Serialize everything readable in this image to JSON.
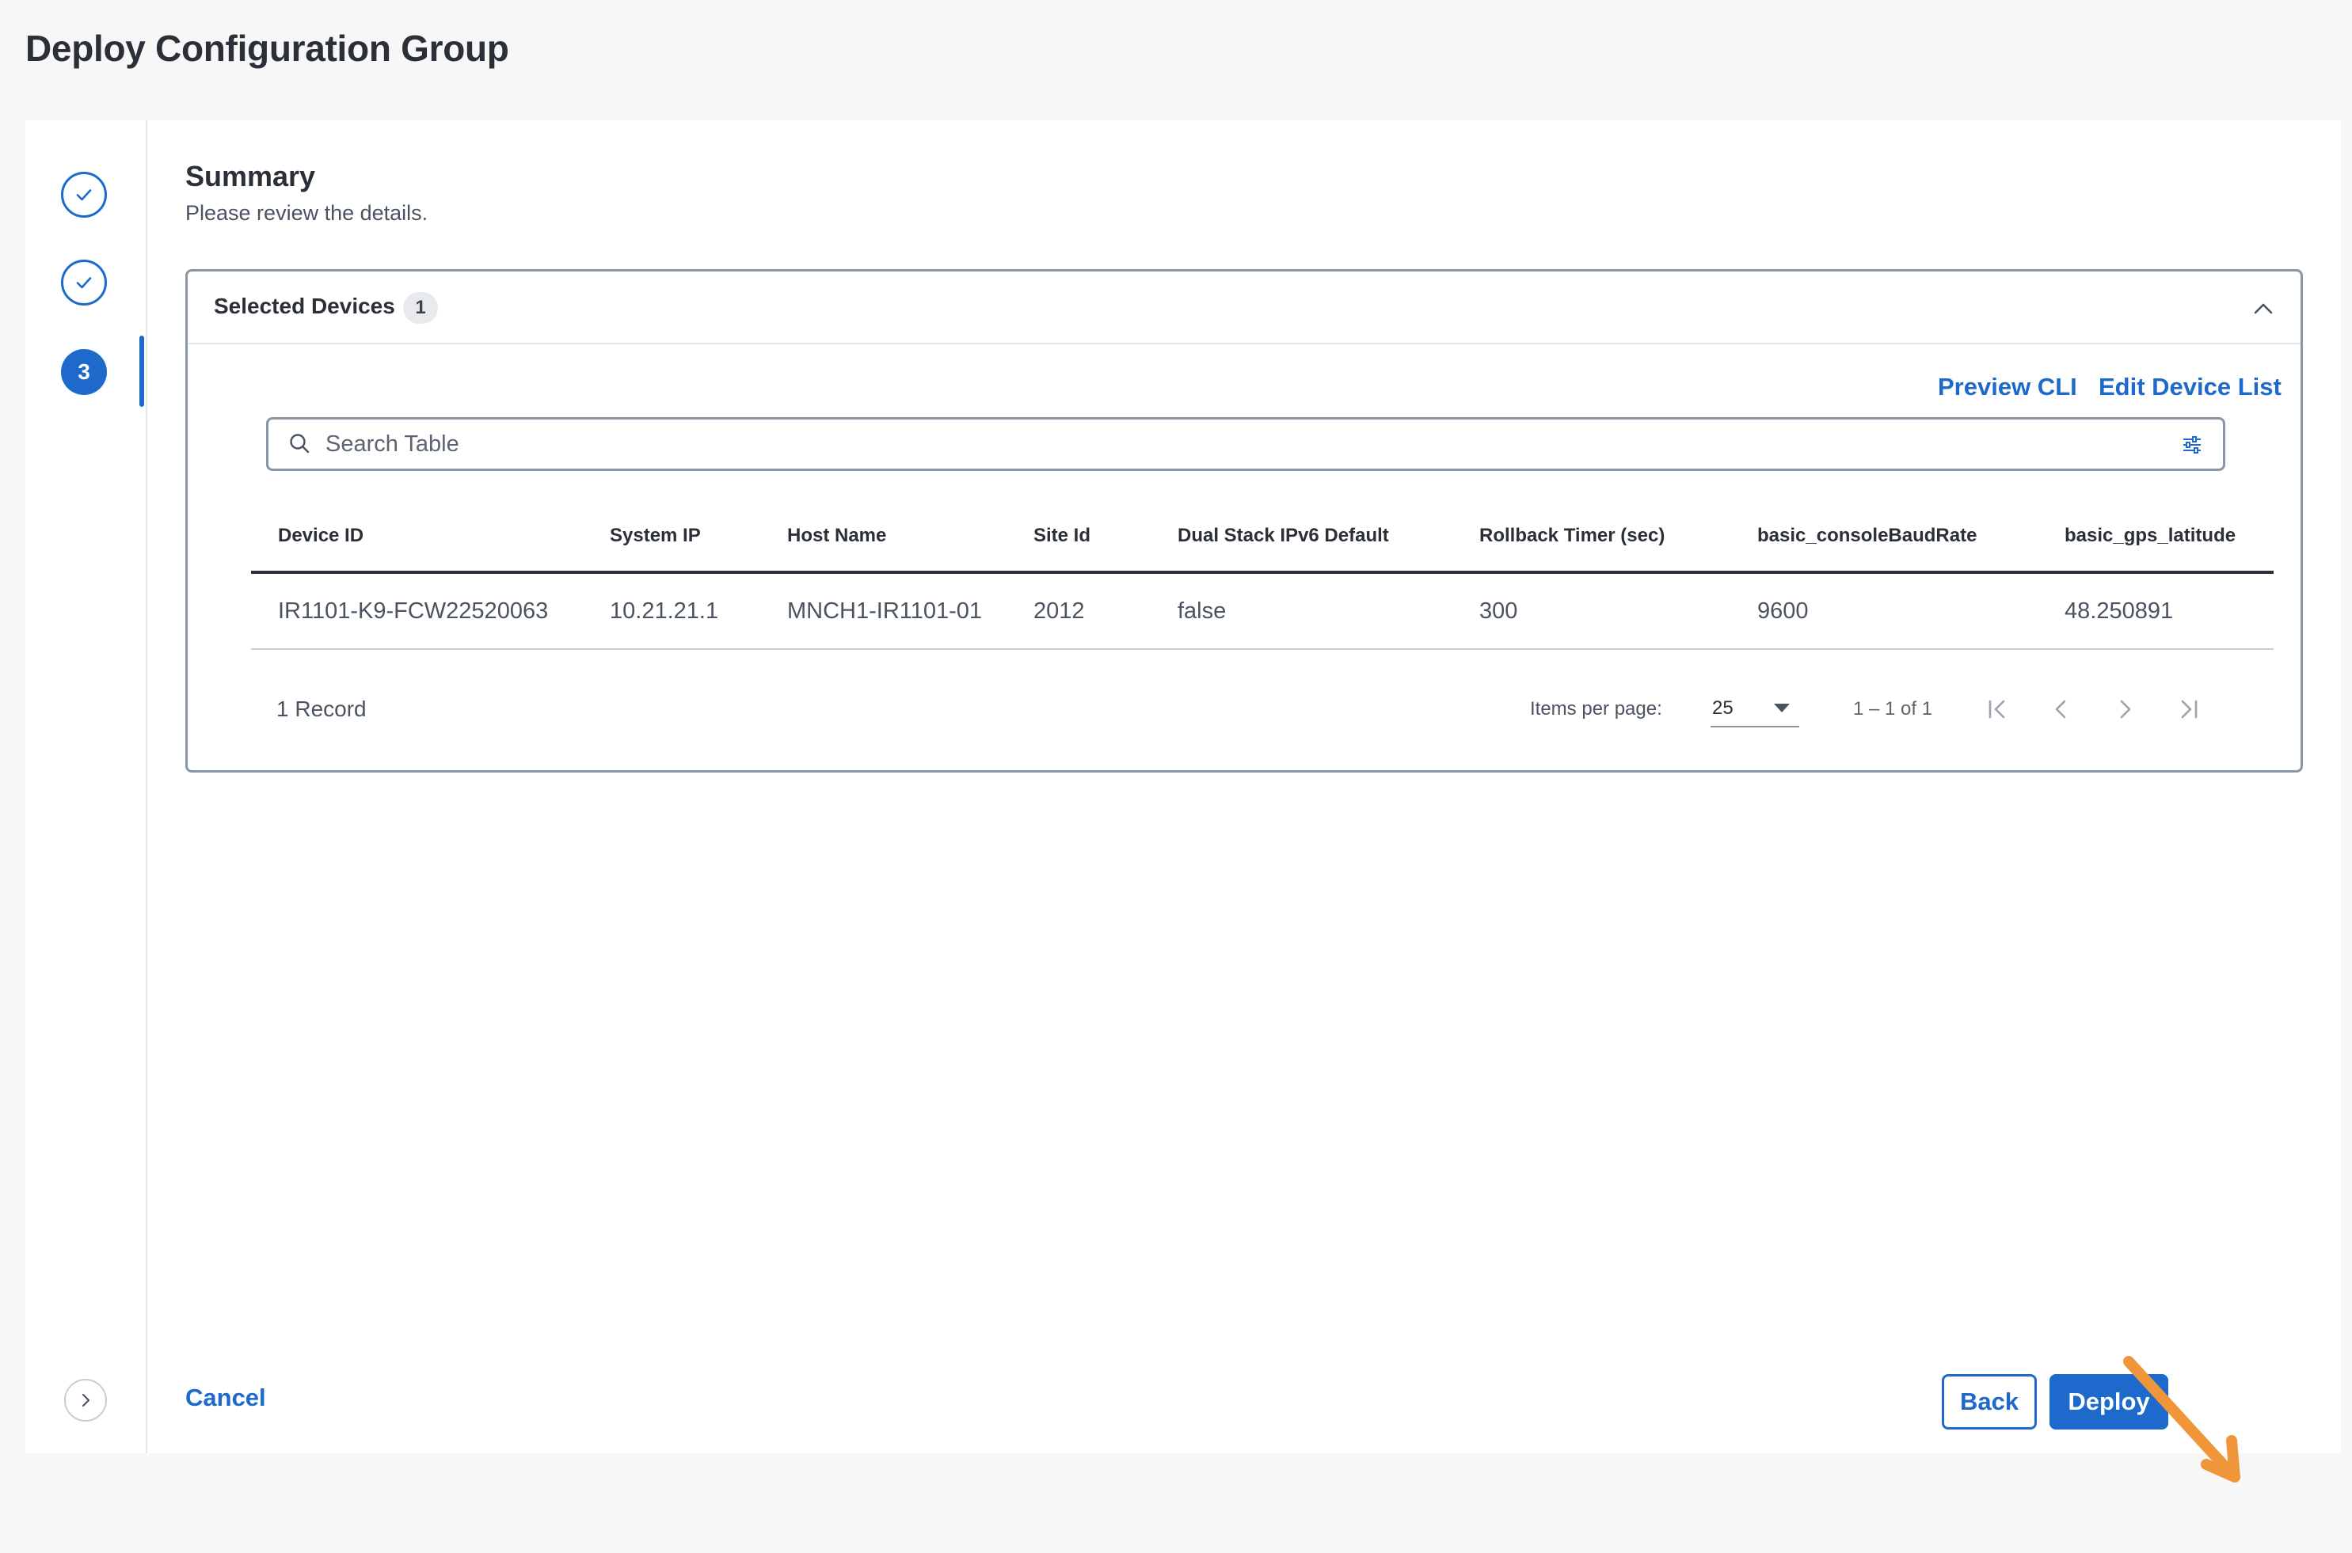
{
  "page_title": "Deploy Configuration Group",
  "stepper": {
    "active_step": "3"
  },
  "summary": {
    "title": "Summary",
    "subtitle": "Please review the details."
  },
  "selected_devices": {
    "title": "Selected Devices",
    "count": "1",
    "preview_cli": "Preview CLI",
    "edit_device_list": "Edit Device List",
    "search_placeholder": "Search Table"
  },
  "table": {
    "headers": [
      "Device ID",
      "System IP",
      "Host Name",
      "Site Id",
      "Dual Stack IPv6 Default",
      "Rollback Timer (sec)",
      "basic_consoleBaudRate",
      "basic_gps_latitude"
    ],
    "rows": [
      [
        "IR1101-K9-FCW22520063",
        "10.21.21.1",
        "MNCH1-IR1101-01",
        "2012",
        "false",
        "300",
        "9600",
        "48.250891"
      ]
    ]
  },
  "pagination": {
    "records": "1 Record",
    "items_per_page_label": "Items per page:",
    "items_per_page": "25",
    "range": "1 – 1 of 1"
  },
  "actions": {
    "cancel": "Cancel",
    "back": "Back",
    "deploy": "Deploy"
  },
  "colors": {
    "accent": "#1d69cc",
    "annotation_arrow": "#f0963a"
  }
}
